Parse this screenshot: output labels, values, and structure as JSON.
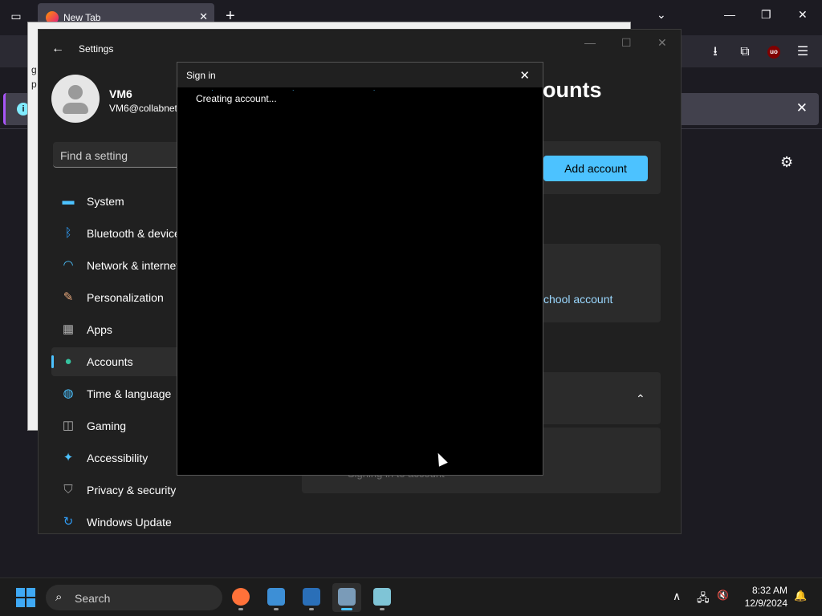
{
  "firefox": {
    "tab_title": "New Tab",
    "tab_close": "✕",
    "new_tab": "+",
    "list_all_tabs_icon": "tab-list-icon",
    "caption_minimize": "—",
    "caption_maximize": "❐",
    "caption_close": "✕",
    "chevron": "⌄",
    "toolbar": {
      "download": "⭳",
      "extensions": "⧉",
      "ublock": "uo",
      "menu": "☰"
    },
    "info_close": "✕",
    "info_icon": "i",
    "gear": "⚙"
  },
  "background_popup": {
    "line1": "g",
    "line2": "p"
  },
  "settings": {
    "back": "←",
    "title": "Settings",
    "user": {
      "name": "VM6",
      "email": "VM6@collabnet"
    },
    "search_placeholder": "Find a setting",
    "nav": [
      {
        "label": "System",
        "icon": "system-icon",
        "color": "#4cc2ff"
      },
      {
        "label": "Bluetooth & devices",
        "icon": "bluetooth-icon",
        "color": "#2f9bf4"
      },
      {
        "label": "Network & internet",
        "icon": "wifi-icon",
        "color": "#4cc2ff"
      },
      {
        "label": "Personalization",
        "icon": "brush-icon",
        "color": "#e8a87c"
      },
      {
        "label": "Apps",
        "icon": "apps-icon",
        "color": "#b0b0b0"
      },
      {
        "label": "Accounts",
        "icon": "accounts-icon",
        "color": "#36c3a0",
        "active": true
      },
      {
        "label": "Time & language",
        "icon": "globe-clock-icon",
        "color": "#4cc2ff"
      },
      {
        "label": "Gaming",
        "icon": "gamepad-icon",
        "color": "#b0b0b0"
      },
      {
        "label": "Accessibility",
        "icon": "accessibility-icon",
        "color": "#4cc2ff"
      },
      {
        "label": "Privacy & security",
        "icon": "shield-icon",
        "color": "#a0a0a0"
      },
      {
        "label": "Windows Update",
        "icon": "update-icon",
        "color": "#2f9bf4"
      }
    ],
    "heading_partial": "ounts",
    "add_account": "Add account",
    "school_link": "chool account",
    "faded_text": "Signing in to account"
  },
  "signin_dialog": {
    "title": "Sign in",
    "close": "✕",
    "status": "Creating account...",
    "dots": "· · ·"
  },
  "taskbar": {
    "search_label": "Search",
    "apps": [
      {
        "name": "firefox",
        "color": "#ff7139"
      },
      {
        "name": "photos",
        "color": "#3d8fd6"
      },
      {
        "name": "powershell",
        "color": "#2a6fb8"
      },
      {
        "name": "settings",
        "color": "#7a9bb8",
        "active": true
      },
      {
        "name": "notepad",
        "color": "#7fc4d6"
      }
    ],
    "tray": {
      "chevron": "∧",
      "network": "🖧",
      "volume": "🔇",
      "notifications": "🔔"
    },
    "time": "8:32 AM",
    "date": "12/9/2024"
  }
}
